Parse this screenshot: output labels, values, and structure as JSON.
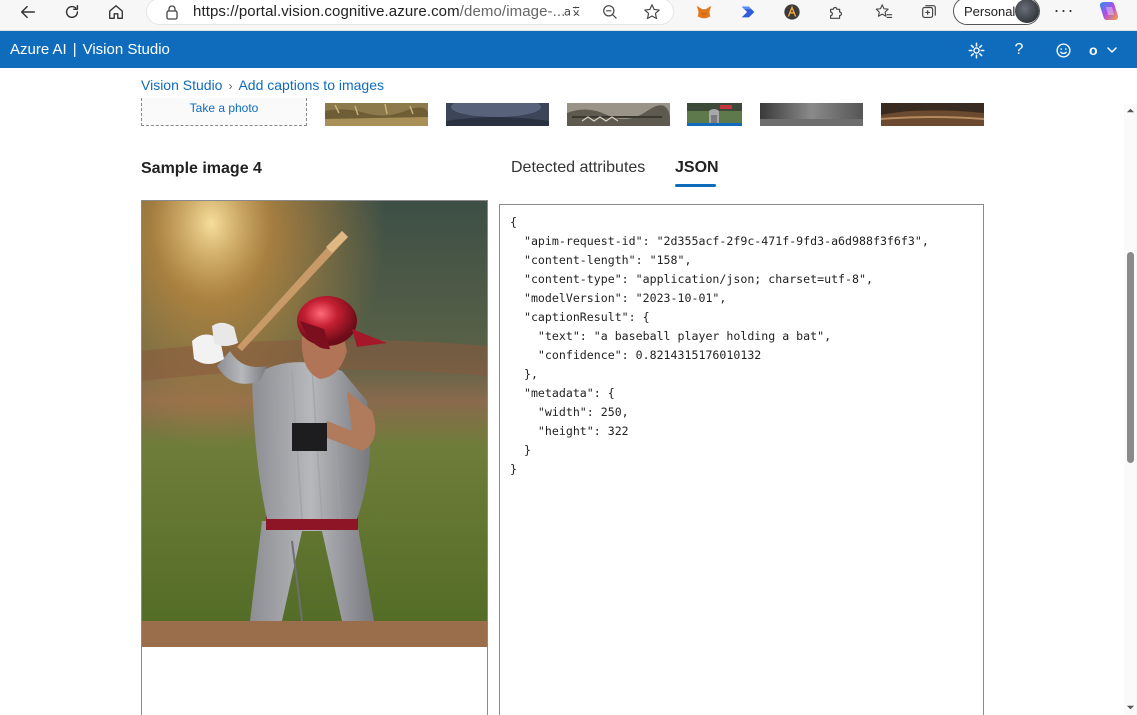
{
  "browser": {
    "url_main": "https://portal.vision.cognitive.azure.com",
    "url_path": "/demo/image-...",
    "profile_label": "Personal",
    "more_label": "···"
  },
  "topbar": {
    "brand": "Azure AI",
    "separator": "|",
    "product": "Vision Studio",
    "help_label": "?",
    "account_initial": "o"
  },
  "breadcrumb": {
    "root": "Vision Studio",
    "current": "Add captions to images"
  },
  "gallery": {
    "take_photo_label": "Take a photo",
    "selected_index": 4
  },
  "sample": {
    "title": "Sample image 4"
  },
  "tabs": [
    {
      "label": "Detected attributes",
      "active": false
    },
    {
      "label": "JSON",
      "active": true
    }
  ],
  "json_result": {
    "text": "{\n  \"apim-request-id\": \"2d355acf-2f9c-471f-9fd3-a6d988f3f6f3\",\n  \"content-length\": \"158\",\n  \"content-type\": \"application/json; charset=utf-8\",\n  \"modelVersion\": \"2023-10-01\",\n  \"captionResult\": {\n    \"text\": \"a baseball player holding a bat\",\n    \"confidence\": 0.8214315176010132\n  },\n  \"metadata\": {\n    \"width\": 250,\n    \"height\": 322\n  }\n}"
  },
  "colors": {
    "azure_blue": "#0f6cbd",
    "link": "#0f6cbd"
  }
}
